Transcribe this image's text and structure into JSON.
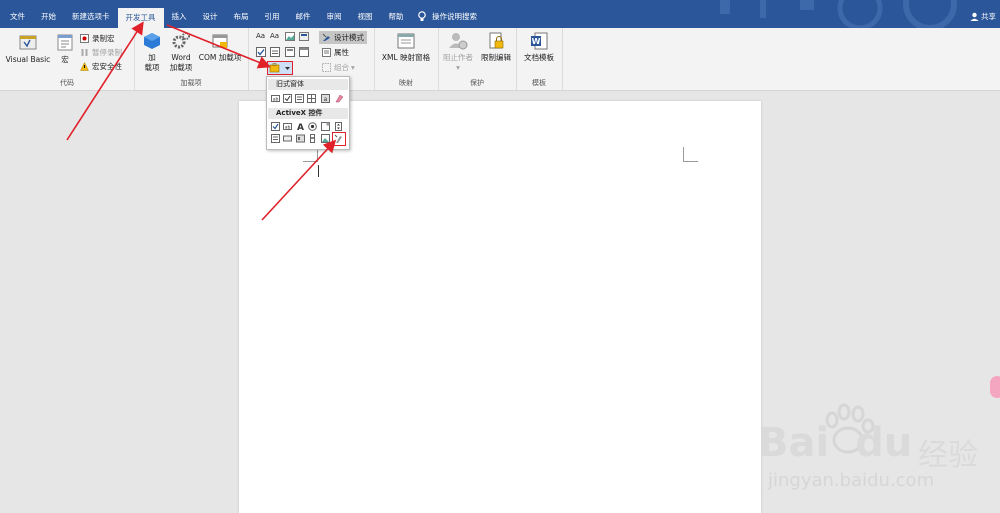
{
  "tabs": [
    "文件",
    "开始",
    "新建选项卡",
    "开发工具",
    "插入",
    "设计",
    "布局",
    "引用",
    "邮件",
    "审阅",
    "视图",
    "帮助"
  ],
  "active_tab": "开发工具",
  "tell_me": "操作说明搜索",
  "share": "共享",
  "groups": {
    "code": {
      "label": "代码",
      "visual_basic": "Visual Basic",
      "macro": "宏",
      "record_macro": "录制宏",
      "pause_recording": "暂停录制",
      "macro_security": "宏安全性"
    },
    "addins": {
      "label": "加载项",
      "addins_btn_line1": "加",
      "addins_btn_line2": "载项",
      "word_addins_line1": "Word",
      "word_addins_line2": "加载项",
      "com_addins": "COM 加载项"
    },
    "controls": {
      "design_mode": "设计模式",
      "properties": "属性",
      "group": "组合"
    },
    "mapping": {
      "label": "映射",
      "xml_pane": "XML 映射窗格"
    },
    "protect": {
      "label": "保护",
      "block_authors": "阻止作者",
      "restrict_editing": "限制编辑"
    },
    "templates": {
      "label": "模板",
      "doc_template": "文档模板"
    }
  },
  "dropdown": {
    "legacy_forms": "旧式窗体",
    "activex": "ActiveX 控件"
  },
  "watermark": {
    "brand": "Bai",
    "brand2": "du",
    "cn": "经验",
    "url": "jingyan.baidu.com"
  },
  "colors": {
    "titlebar": "#2b579a",
    "arrow": "#e0212a"
  }
}
